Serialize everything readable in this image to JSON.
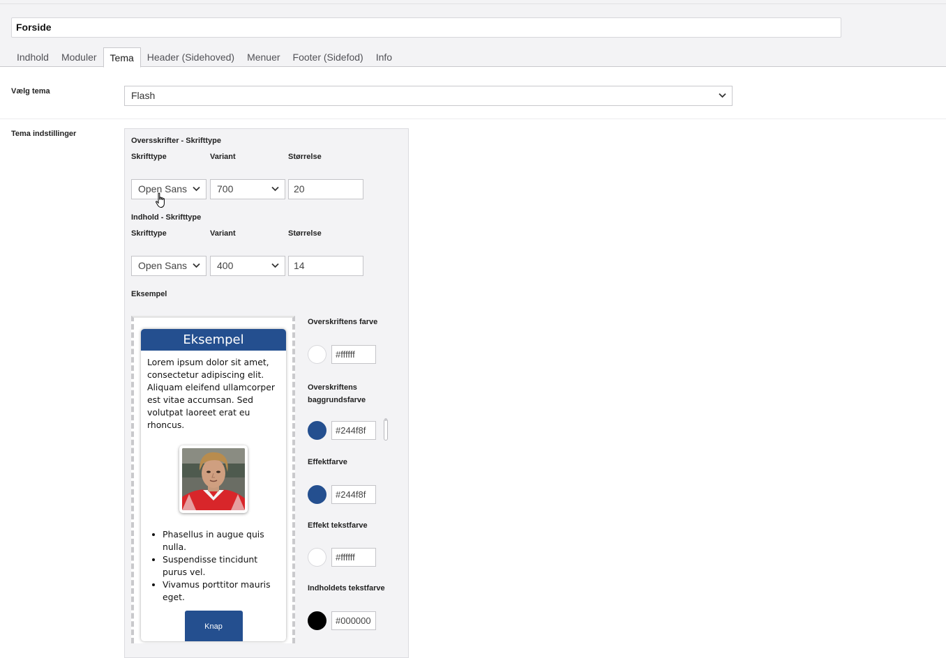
{
  "header": {
    "page_title": "Forside",
    "tabs": [
      {
        "label": "Indhold"
      },
      {
        "label": "Moduler"
      },
      {
        "label": "Tema"
      },
      {
        "label": "Header (Sidehoved)"
      },
      {
        "label": "Menuer"
      },
      {
        "label": "Footer (Sidefod)"
      },
      {
        "label": "Info"
      }
    ],
    "active_tab": "Tema"
  },
  "theme": {
    "select_label": "Vælg tema",
    "selected": "Flash",
    "settings_label": "Tema indstillinger"
  },
  "headings_font": {
    "section_title": "Oversskrifter - Skrifttype",
    "col_font": "Skrifttype",
    "col_variant": "Variant",
    "col_size": "Størrelse",
    "font": "Open Sans",
    "variant": "700",
    "size": "20"
  },
  "content_font": {
    "section_title": "Indhold - Skrifttype",
    "col_font": "Skrifttype",
    "col_variant": "Variant",
    "col_size": "Størrelse",
    "font": "Open Sans",
    "variant": "400",
    "size": "14"
  },
  "example": {
    "label": "Eksempel",
    "card_title": "Eksempel",
    "paragraph": "Lorem ipsum dolor sit amet, consectetur adipiscing elit. Aliquam eleifend ullamcorper est vitae accumsan. Sed volutpat laoreet erat eu rhoncus.",
    "bullets": [
      "Phasellus in augue quis nulla.",
      "Suspendisse tincidunt purus vel.",
      "Vivamus porttitor mauris eget."
    ],
    "button_label": "Knap"
  },
  "colors": [
    {
      "label": "Overskriftens farve",
      "value": "#ffffff"
    },
    {
      "label": "Overskriftens baggrundsfarve",
      "value": "#244f8f"
    },
    {
      "label": "Effektfarve",
      "value": "#244f8f"
    },
    {
      "label": "Effekt tekstfarve",
      "value": "#ffffff"
    },
    {
      "label": "Indholdets tekstfarve",
      "value": "#000000"
    }
  ]
}
